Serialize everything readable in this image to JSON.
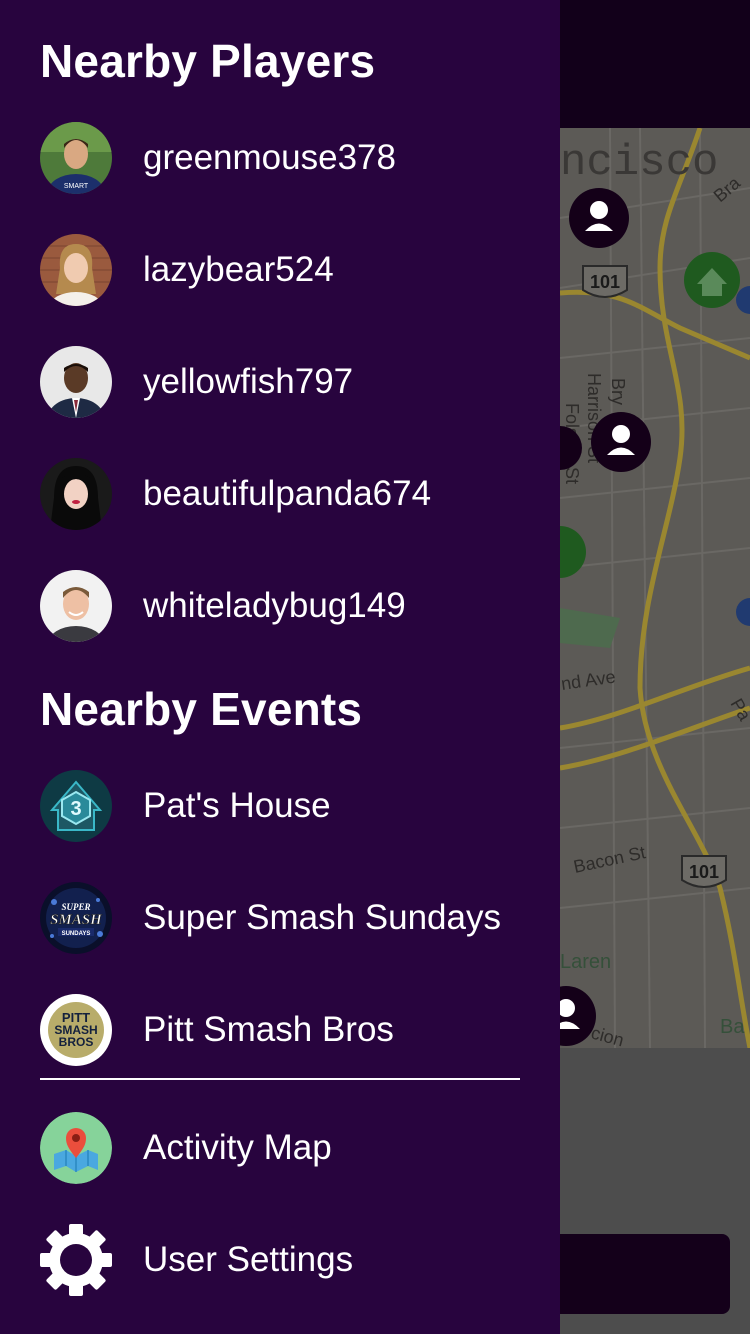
{
  "map": {
    "labels": {
      "city": "ncisco",
      "hwy1": "101",
      "hwy2": "101",
      "street1": "Harrison St",
      "street2": "Folsom St",
      "street3": "Bry",
      "street4": "nd Ave",
      "street5": "Bacon St",
      "street6": "Laren",
      "street7": "Bra",
      "street8": "Pa",
      "street9": "Ba",
      "street10": "cion"
    }
  },
  "drawer": {
    "players_title": "Nearby Players",
    "players": [
      {
        "name": "greenmouse378",
        "avatar": "avatar-man-green-shirt"
      },
      {
        "name": "lazybear524",
        "avatar": "avatar-woman-brick-wall"
      },
      {
        "name": "yellowfish797",
        "avatar": "avatar-man-suit"
      },
      {
        "name": "beautifulpanda674",
        "avatar": "avatar-woman-dark-hair"
      },
      {
        "name": "whiteladybug149",
        "avatar": "avatar-man-smiling"
      }
    ],
    "events_title": "Nearby Events",
    "events": [
      {
        "name": "Pat's House",
        "icon": "house-badge-icon"
      },
      {
        "name": "Super Smash Sundays",
        "icon": "super-smash-sundays-logo"
      },
      {
        "name": "Pitt Smash Bros",
        "icon": "pitt-smash-bros-logo"
      }
    ],
    "logo_text": {
      "pats_house": "3",
      "sss_line1": "SUPER",
      "sss_line2": "SMASH",
      "sss_line3": "SUNDAYS",
      "psb_line1": "PITT",
      "psb_line2": "SMASH",
      "psb_line3": "BROS"
    },
    "nav": [
      {
        "label": "Activity Map",
        "icon": "map-pin-icon"
      },
      {
        "label": "User Settings",
        "icon": "gear-icon"
      }
    ]
  },
  "colors": {
    "drawer_bg": "#28043e",
    "text": "#ffffff",
    "map_road": "#9a8730",
    "map_pin_green": "#1f5a1f",
    "map_pin_dark": "#140018"
  }
}
